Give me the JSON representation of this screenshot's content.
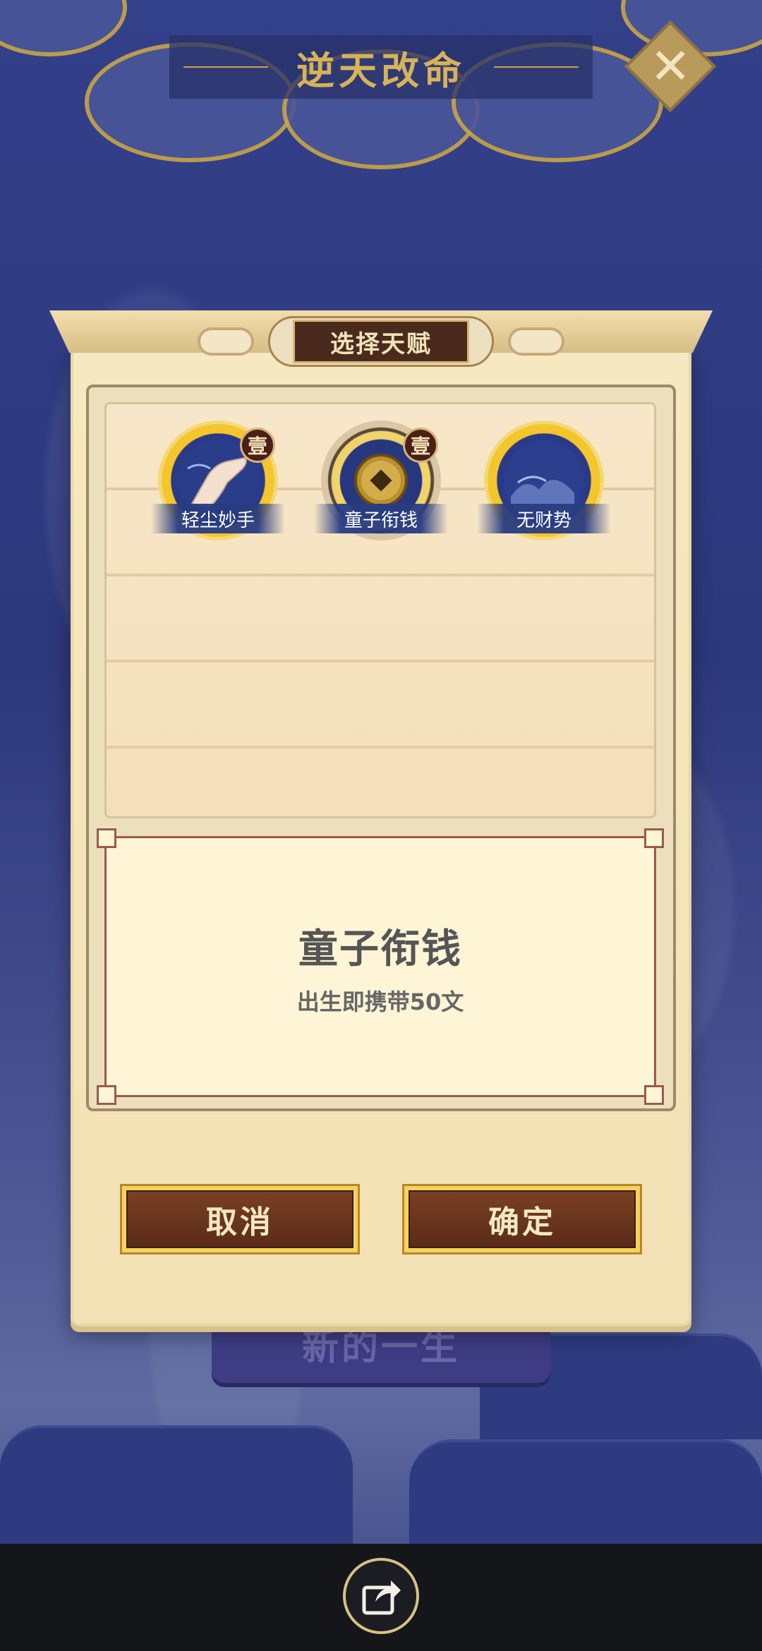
{
  "header": {
    "title": "逆天改命"
  },
  "background": {
    "start_button_label": "新的一生"
  },
  "dialog": {
    "title": "选择天赋",
    "talents": [
      {
        "label": "轻尘妙手",
        "badge": "壹",
        "icon": "hand-icon",
        "selected": false
      },
      {
        "label": "童子衔钱",
        "badge": "壹",
        "icon": "coin-icon",
        "selected": true
      },
      {
        "label": "无财势",
        "badge": "",
        "icon": "dust-icon",
        "selected": false
      }
    ],
    "description": {
      "title": "童子衔钱",
      "text": "出生即携带50文"
    },
    "cancel_label": "取消",
    "confirm_label": "确定"
  },
  "bottom_bar": {
    "share_icon": "share-icon"
  },
  "colors": {
    "gold": "#c9a646",
    "background_blue": "#2f3878",
    "button_brown": "#6b3520",
    "panel_cream": "#f5e6bd"
  }
}
